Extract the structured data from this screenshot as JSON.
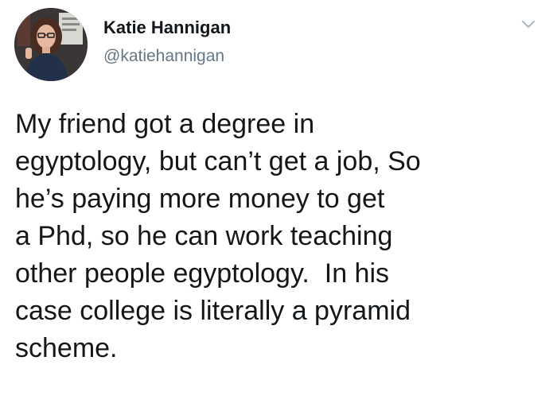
{
  "author": {
    "display_name": "Katie Hannigan",
    "handle": "@katiehannigan"
  },
  "icons": {
    "avatar": "profile-photo",
    "menu": "chevron-down-icon"
  },
  "tweet": {
    "lines": [
      "My friend got a degree in",
      "egyptology, but can’t get a job, So",
      "he’s paying more money to get",
      "a Phd, so he can work teaching",
      "other people egyptology.  In his",
      "case college is literally a pyramid",
      "scheme."
    ]
  },
  "colors": {
    "text": "#14171a",
    "secondary_text": "#657786",
    "chevron": "#aab8c2",
    "background": "#ffffff"
  }
}
